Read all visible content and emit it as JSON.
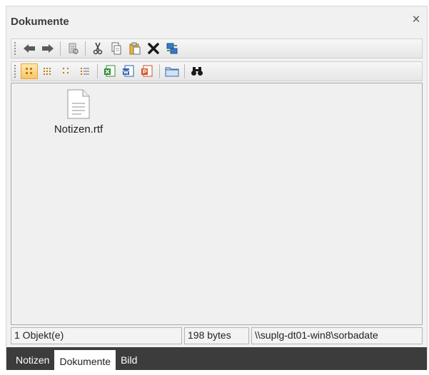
{
  "panel": {
    "title": "Dokumente",
    "close_glyph": "×"
  },
  "toolbar1": {
    "buttons": [
      {
        "icon": "back-arrow-icon"
      },
      {
        "icon": "forward-arrow-icon"
      },
      {
        "icon": "sync-icon"
      },
      {
        "icon": "cut-icon"
      },
      {
        "icon": "copy-icon"
      },
      {
        "icon": "paste-icon"
      },
      {
        "icon": "delete-icon"
      },
      {
        "icon": "network-icon"
      }
    ]
  },
  "toolbar2": {
    "buttons": [
      {
        "icon": "large-icons-view-icon",
        "active": true
      },
      {
        "icon": "small-icons-view-icon"
      },
      {
        "icon": "list-view-icon"
      },
      {
        "icon": "details-view-icon"
      },
      {
        "icon": "excel-icon"
      },
      {
        "icon": "word-icon"
      },
      {
        "icon": "powerpoint-icon"
      },
      {
        "icon": "folder-icon"
      },
      {
        "icon": "binoculars-icon"
      }
    ]
  },
  "content": {
    "files": [
      {
        "name": "Notizen.rtf",
        "icon": "rtf-document-icon"
      }
    ]
  },
  "statusbar": {
    "count": "1 Objekt(e)",
    "size": "198 bytes",
    "path": "\\\\suplg-dt01-win8\\sorbadate"
  },
  "tabs": [
    {
      "label": "Notizen",
      "active": false
    },
    {
      "label": "Dokumente",
      "active": true
    },
    {
      "label": "Bild",
      "active": false
    }
  ],
  "colors": {
    "tab_bar": "#3c3c3c",
    "active_button": "#f8c564"
  }
}
